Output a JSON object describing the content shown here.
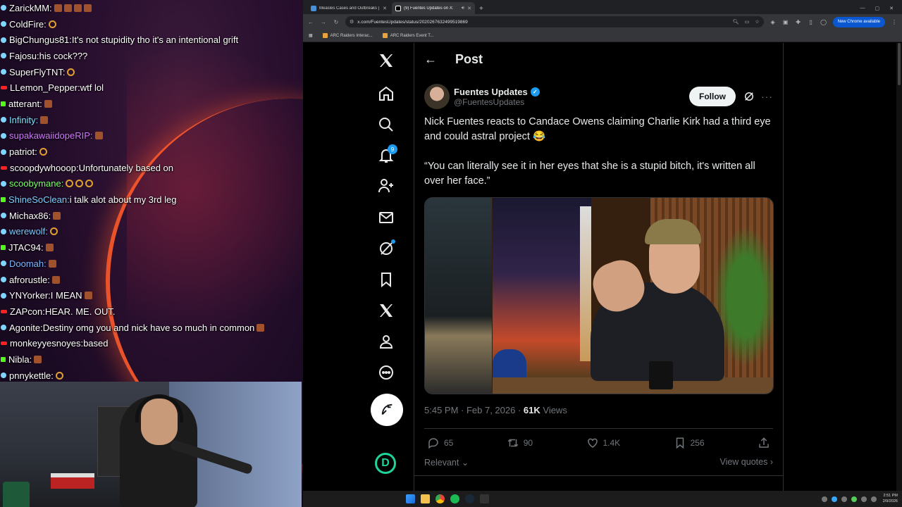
{
  "chat": {
    "messages": [
      {
        "platform": "rumble",
        "user": "ZarickMM:",
        "user_color": "#ffffff",
        "text": "",
        "emotes": [
          "sq",
          "sq",
          "sq",
          "sq"
        ]
      },
      {
        "platform": "rumble",
        "user": "ColdFire:",
        "user_color": "#ffffff",
        "text": "",
        "emotes": [
          "ring"
        ]
      },
      {
        "platform": "rumble",
        "user": "BigChungus81:",
        "user_color": "#ffffff",
        "text": "It's not stupidity tho it's an intentional grift",
        "emotes": []
      },
      {
        "platform": "rumble",
        "user": "Fajosu:",
        "user_color": "#ffffff",
        "text": "his cock???",
        "emotes": []
      },
      {
        "platform": "rumble",
        "user": "SuperFlyTNT:",
        "user_color": "#ffffff",
        "text": "",
        "emotes": [
          "ring"
        ]
      },
      {
        "platform": "yt",
        "user": "LLemon_Pepper:",
        "user_color": "#ffffff",
        "text": "wtf lol",
        "emotes": []
      },
      {
        "platform": "kick",
        "user": "atterant:",
        "user_color": "#ffffff",
        "text": "",
        "emotes": [
          "sq"
        ]
      },
      {
        "platform": "rumble",
        "user": "Infinity:",
        "user_color": "#7fe0ff",
        "text": "",
        "emotes": [
          "sq"
        ]
      },
      {
        "platform": "rumble",
        "user": "supakawaiidopeRIP:",
        "user_color": "#d07bff",
        "text": "",
        "emotes": [
          "sq"
        ]
      },
      {
        "platform": "rumble",
        "user": "patriot:",
        "user_color": "#ffffff",
        "text": "",
        "emotes": [
          "ring"
        ]
      },
      {
        "platform": "yt",
        "user": "scoopdywhooop:",
        "user_color": "#ffffff",
        "text": "Unfortunately based on",
        "emotes": []
      },
      {
        "platform": "rumble",
        "user": "scoobymane:",
        "user_color": "#7dff6b",
        "text": "",
        "emotes": [
          "ring",
          "ring",
          "ring"
        ]
      },
      {
        "platform": "kick",
        "user": "ShineSoClean:",
        "user_color": "#7fd0ff",
        "text": "i talk alot about my 3rd leg",
        "emotes": []
      },
      {
        "platform": "rumble",
        "user": "Michax86:",
        "user_color": "#ffffff",
        "text": "",
        "emotes": [
          "sq"
        ]
      },
      {
        "platform": "rumble",
        "user": "werewolf:",
        "user_color": "#7fc8ff",
        "text": "",
        "emotes": [
          "ring"
        ]
      },
      {
        "platform": "kick",
        "user": "JTAC94:",
        "user_color": "#ffffff",
        "text": "",
        "emotes": [
          "sq"
        ]
      },
      {
        "platform": "rumble",
        "user": "Doomah:",
        "user_color": "#7fb8ff",
        "text": "",
        "emotes": [
          "sq"
        ]
      },
      {
        "platform": "rumble",
        "user": "afrorustle:",
        "user_color": "#ffffff",
        "text": "",
        "emotes": [
          "sq"
        ]
      },
      {
        "platform": "rumble",
        "user": "YNYorker:",
        "user_color": "#ffffff",
        "text": " I MEAN",
        "emotes": [
          "sq"
        ]
      },
      {
        "platform": "yt",
        "user": "ZAPcon:",
        "user_color": "#ffffff",
        "text": "HEAR. ME. OUT.",
        "emotes": []
      },
      {
        "platform": "rumble",
        "user": "Agonite:",
        "user_color": "#ffffff",
        "text": "Destiny omg you and nick have so much in common",
        "emotes": [
          "sq"
        ]
      },
      {
        "platform": "yt",
        "user": "monkeyyesnoyes:",
        "user_color": "#ffffff",
        "text": "based",
        "emotes": []
      },
      {
        "platform": "kick",
        "user": "Nibla:",
        "user_color": "#ffffff",
        "text": "",
        "emotes": [
          "sq"
        ]
      },
      {
        "platform": "rumble",
        "user": "pnnykettle:",
        "user_color": "#ffffff",
        "text": "",
        "emotes": [
          "ring"
        ]
      }
    ]
  },
  "browser": {
    "tabs": [
      {
        "label": "Measles Cases and Outbreaks |",
        "active": false,
        "favicon_color": "#4a90d9"
      },
      {
        "label": "(9) Fuentes Updates on X:",
        "active": true,
        "favicon_color": "#ffffff"
      }
    ],
    "new_tab": "+",
    "url": "x.com/FuentesUpdates/status/2020267632499519869",
    "update_button": "New Chrome available",
    "bookmarks": [
      "ARC Raiders Interac...",
      "ARC Raiders Event T..."
    ]
  },
  "x": {
    "header_title": "Post",
    "nav": {
      "notifications_badge": "9"
    },
    "author": {
      "display_name": "Fuentes Updates",
      "handle": "@FuentesUpdates",
      "follow_label": "Follow"
    },
    "post": {
      "text_1": "Nick Fuentes reacts to Candace Owens claiming Charlie Kirk had a third eye and could astral project 😂",
      "text_2": "“You can literally see it in her eyes that she is a stupid bitch, it's written all over her face.”"
    },
    "media": {
      "hat_text": "ERICA\nIRST",
      "mug_text": "AF"
    },
    "meta": {
      "time_date": "5:45 PM · Feb 7, 2026 · ",
      "views_count": "61K",
      "views_label": " Views"
    },
    "actions": {
      "replies": "65",
      "reposts": "90",
      "likes": "1.4K",
      "bookmarks": "256"
    },
    "reply_sort": "Relevant",
    "view_quotes": "View quotes"
  },
  "taskbar": {
    "time": "2:51 PM",
    "date": "2/9/2026"
  },
  "colors": {
    "x_blue": "#1d9bf0",
    "x_bg": "#000000",
    "x_text": "#e7e9ea",
    "x_muted": "#71767b"
  }
}
